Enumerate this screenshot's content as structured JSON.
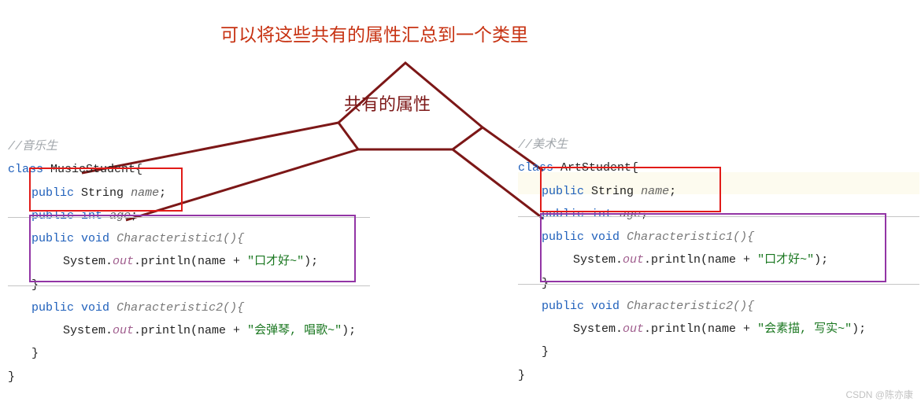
{
  "title": "可以将这些共有的属性汇总到一个类里",
  "shared_label": "共有的属性",
  "left": {
    "comment": "//音乐生",
    "class_decl_kw": "class",
    "class_name": "MusicStudent{",
    "field1_kw": "public",
    "field1_type": "String",
    "field1_name": "name",
    "field2_kw": "public",
    "field2_type": "int",
    "field2_name": "age",
    "m1_kw1": "public",
    "m1_kw2": "void",
    "m1_name": "Characteristic1(){",
    "m1_body_pre": "System.",
    "m1_body_out": "out",
    "m1_body_mid": ".println(name + ",
    "m1_body_str": "\"口才好~\"",
    "m1_body_end": ");",
    "m1_close": "}",
    "m2_kw1": "public",
    "m2_kw2": "void",
    "m2_name": "Characteristic2(){",
    "m2_body_pre": "System.",
    "m2_body_out": "out",
    "m2_body_mid": ".println(name + ",
    "m2_body_str": "\"会弹琴, 唱歌~\"",
    "m2_body_end": ");",
    "m2_close": "}",
    "class_close": "}"
  },
  "right": {
    "comment": "//美术生",
    "class_decl_kw": "class",
    "class_name": "ArtStudent{",
    "field1_kw": "public",
    "field1_type": "String",
    "field1_name": "name",
    "field2_kw": "public",
    "field2_type": "int",
    "field2_name": "age",
    "m1_kw1": "public",
    "m1_kw2": "void",
    "m1_name": "Characteristic1(){",
    "m1_body_pre": "System.",
    "m1_body_out": "out",
    "m1_body_mid": ".println(name + ",
    "m1_body_str": "\"口才好~\"",
    "m1_body_end": ");",
    "m1_close": "}",
    "m2_kw1": "public",
    "m2_kw2": "void",
    "m2_name": "Characteristic2(){",
    "m2_body_pre": "System.",
    "m2_body_out": "out",
    "m2_body_mid": ".println(name + ",
    "m2_body_str": "\"会素描, 写实~\"",
    "m2_body_end": ");",
    "m2_close": "}",
    "class_close": "}"
  },
  "watermark": "CSDN @陈亦康"
}
